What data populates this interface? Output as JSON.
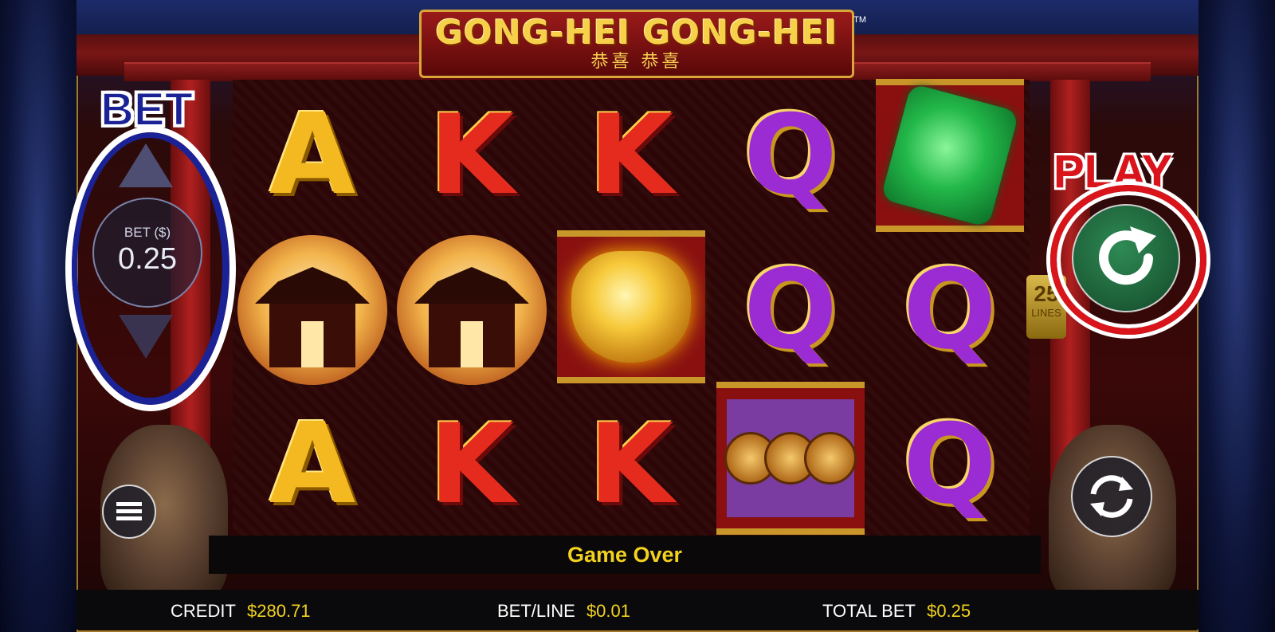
{
  "game": {
    "title": "GONG-HEI GONG-HEI",
    "subtitle": "恭喜 恭喜",
    "trademark": "TM"
  },
  "reels": [
    [
      "A",
      "temple",
      "A"
    ],
    [
      "K",
      "temple",
      "K"
    ],
    [
      "K",
      "gold-pot",
      "K"
    ],
    [
      "Q",
      "Q",
      "coins"
    ],
    [
      "jade",
      "Q",
      "Q"
    ]
  ],
  "lines": {
    "count": "25",
    "label": "LINES"
  },
  "bet_control": {
    "annotation": "BET",
    "label": "BET ($)",
    "value": "0.25"
  },
  "play_control": {
    "annotation": "PLAY"
  },
  "message": "Game Over",
  "status": {
    "credit_label": "CREDIT",
    "credit_value": "$280.71",
    "betline_label": "BET/LINE",
    "betline_value": "$0.01",
    "totalbet_label": "TOTAL BET",
    "totalbet_value": "$0.25"
  },
  "colors": {
    "annotation_bet": "#1b2296",
    "annotation_play": "#d9141b",
    "message_text": "#f2d21e"
  }
}
